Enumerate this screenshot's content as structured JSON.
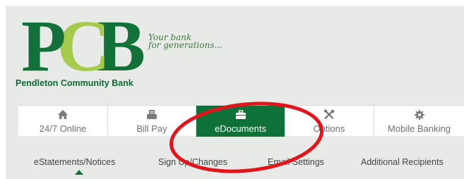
{
  "brand": {
    "logo_letters": [
      "P",
      "C",
      "B"
    ],
    "tagline_lines": [
      "Your bank",
      "for generations..."
    ],
    "bank_name": "Pendleton Community Bank",
    "colors": {
      "dark_green": "#127138",
      "light_green": "#a6cb4c",
      "background": "#e7eae7"
    }
  },
  "nav": {
    "tabs": [
      {
        "label": "24/7 Online",
        "icon": "home-icon",
        "active": false
      },
      {
        "label": "Bill Pay",
        "icon": "bill-pay-icon",
        "active": false
      },
      {
        "label": "eDocuments",
        "icon": "briefcase-icon",
        "active": true
      },
      {
        "label": "Options",
        "icon": "tools-icon",
        "active": false
      },
      {
        "label": "Mobile Banking",
        "icon": "gear-icon",
        "active": false
      }
    ],
    "active_color": "#0e7137"
  },
  "subnav": {
    "items": [
      "eStatements/Notices",
      "Sign Up/Changes",
      "Email Settings",
      "Additional Recipients"
    ],
    "active_index": 0
  },
  "annotation": {
    "shape": "ellipse",
    "color": "#e3141b",
    "target": "eDocuments"
  }
}
